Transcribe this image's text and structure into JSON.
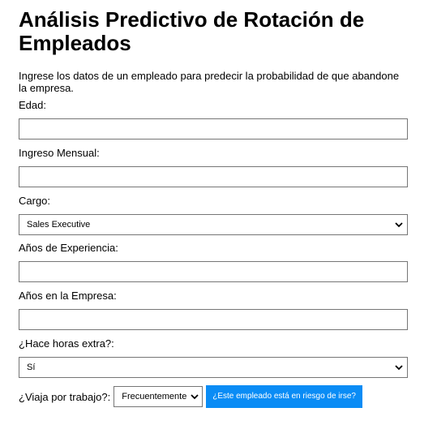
{
  "title": "Análisis Predictivo de Rotación de Empleados",
  "intro": "Ingrese los datos de un empleado para predecir la probabilidad de que abandone la empresa.",
  "fields": {
    "edad": {
      "label": "Edad:",
      "value": ""
    },
    "ingreso": {
      "label": "Ingreso Mensual:",
      "value": ""
    },
    "cargo": {
      "label": "Cargo:",
      "selected": "Sales Executive"
    },
    "experiencia": {
      "label": "Años de Experiencia:",
      "value": ""
    },
    "empresa": {
      "label": "Años en la Empresa:",
      "value": ""
    },
    "horas_extra": {
      "label": "¿Hace horas extra?:",
      "selected": "Sí"
    },
    "viaja": {
      "label": "¿Viaja por trabajo?:",
      "selected": "Frecuentemente"
    }
  },
  "submit_label": "¿Este empleado está en riesgo de irse?",
  "colors": {
    "button_bg": "#0a8cf5",
    "button_text": "#ffffff",
    "border": "#767676"
  }
}
